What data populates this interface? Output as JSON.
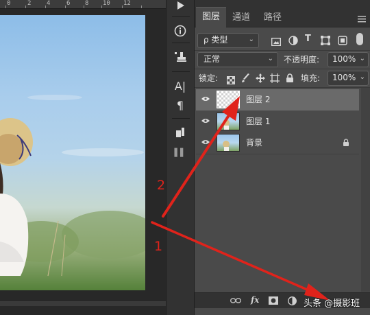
{
  "ruler": {
    "numbers": [
      "0",
      "2",
      "4",
      "6",
      "8",
      "10",
      "12"
    ]
  },
  "panel": {
    "tabs": [
      {
        "label": "图层",
        "active": true
      },
      {
        "label": "通道",
        "active": false
      },
      {
        "label": "路径",
        "active": false
      }
    ],
    "filter": {
      "label": "ρ 类型"
    },
    "blend_mode": "正常",
    "opacity": {
      "label": "不透明度:",
      "value": "100%"
    },
    "lock": {
      "label": "锁定:"
    },
    "fill": {
      "label": "填充:",
      "value": "100%"
    },
    "layers": [
      {
        "name": "图层 2",
        "selected": true,
        "thumb": "transparent",
        "locked": false
      },
      {
        "name": "图层 1",
        "selected": false,
        "thumb": "photo",
        "locked": false
      },
      {
        "name": "背景",
        "selected": false,
        "thumb": "photo",
        "locked": true
      }
    ],
    "footer_icons": [
      "link-icon",
      "fx-icon",
      "mask-icon",
      "adjustment-icon"
    ]
  },
  "toolbar": {
    "icons": [
      "play-icon",
      "info-icon",
      "stamp-icon",
      "character-icon",
      "paragraph-icon",
      "glyph-icon"
    ]
  },
  "annotations": {
    "number_1": "1",
    "number_2": "2",
    "color": "#e0231b"
  },
  "watermark": "头条 @摄影班"
}
